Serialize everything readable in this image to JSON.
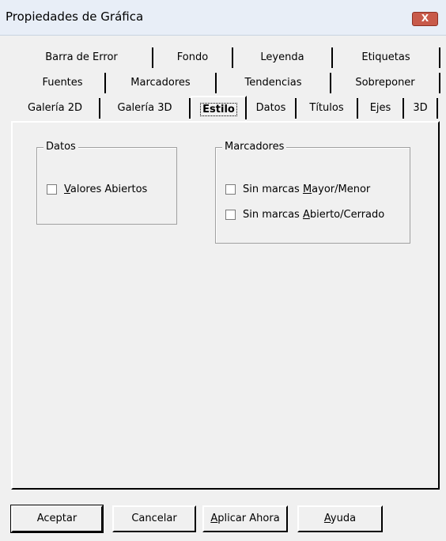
{
  "window": {
    "title": "Propiedades de Gráfica",
    "close_label": "X"
  },
  "tabs": {
    "row1": [
      "Barra de Error",
      "Fondo",
      "Leyenda",
      "Etiquetas"
    ],
    "row2": [
      "Fuentes",
      "Marcadores",
      "Tendencias",
      "Sobreponer"
    ],
    "row3": [
      "Galería 2D",
      "Galería 3D",
      "Estilo",
      "Datos",
      "Títulos",
      "Ejes",
      "3D"
    ],
    "active": "Estilo"
  },
  "groups": {
    "datos": {
      "legend": "Datos",
      "options": [
        {
          "prefix": "",
          "underline": "V",
          "rest": "alores Abiertos",
          "checked": false
        }
      ]
    },
    "marcadores": {
      "legend": "Marcadores",
      "options": [
        {
          "prefix": "Sin marcas ",
          "underline": "M",
          "rest": "ayor/Menor",
          "checked": false
        },
        {
          "prefix": "Sin marcas ",
          "underline": "A",
          "rest": "bierto/Cerrado",
          "checked": false
        }
      ]
    }
  },
  "buttons": {
    "accept": "Aceptar",
    "cancel": "Cancelar",
    "apply": {
      "underline": "A",
      "rest": "plicar Ahora"
    },
    "help": {
      "underline": "A",
      "rest": "yuda"
    }
  }
}
